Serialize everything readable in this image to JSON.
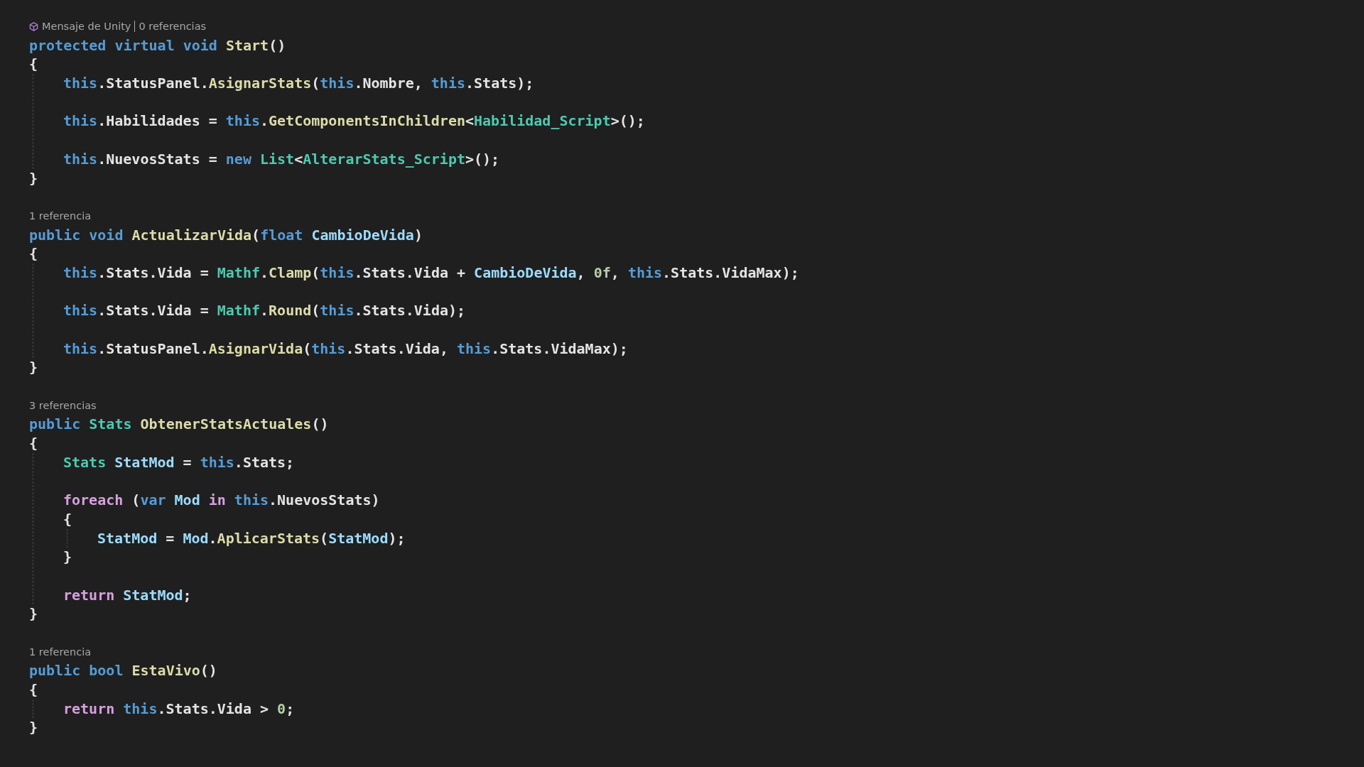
{
  "editor": {
    "members": [
      {
        "lens": [
          {
            "kind": "unity",
            "text": "Mensaje de Unity"
          },
          {
            "kind": "refs",
            "text": "0 referencias"
          }
        ],
        "signature": [
          {
            "kind": "kw",
            "text": "protected virtual void"
          },
          {
            "kind": "fn",
            "text": " Start"
          },
          {
            "kind": "p",
            "text": "()"
          }
        ],
        "open": "{",
        "close": "}",
        "body": [
          {
            "kind": "stmt",
            "tokens": [
              {
                "kind": "kw",
                "text": "this"
              },
              {
                "kind": "p",
                "text": "."
              },
              {
                "kind": "id",
                "text": "StatusPanel"
              },
              {
                "kind": "p",
                "text": "."
              },
              {
                "kind": "fn",
                "text": "AsignarStats"
              },
              {
                "kind": "p",
                "text": "("
              },
              {
                "kind": "kw",
                "text": "this"
              },
              {
                "kind": "p",
                "text": "."
              },
              {
                "kind": "id",
                "text": "Nombre"
              },
              {
                "kind": "p",
                "text": ", "
              },
              {
                "kind": "kw",
                "text": "this"
              },
              {
                "kind": "p",
                "text": "."
              },
              {
                "kind": "id",
                "text": "Stats"
              },
              {
                "kind": "p",
                "text": ");"
              }
            ]
          },
          {
            "kind": "blank"
          },
          {
            "kind": "stmt",
            "tokens": [
              {
                "kind": "kw",
                "text": "this"
              },
              {
                "kind": "p",
                "text": "."
              },
              {
                "kind": "id",
                "text": "Habilidades"
              },
              {
                "kind": "p",
                "text": " = "
              },
              {
                "kind": "kw",
                "text": "this"
              },
              {
                "kind": "p",
                "text": "."
              },
              {
                "kind": "fn",
                "text": "GetComponentsInChildren"
              },
              {
                "kind": "p",
                "text": "<"
              },
              {
                "kind": "type",
                "text": "Habilidad_Script"
              },
              {
                "kind": "p",
                "text": ">();"
              }
            ]
          },
          {
            "kind": "blank"
          },
          {
            "kind": "stmt",
            "tokens": [
              {
                "kind": "kw",
                "text": "this"
              },
              {
                "kind": "p",
                "text": "."
              },
              {
                "kind": "id",
                "text": "NuevosStats"
              },
              {
                "kind": "p",
                "text": " = "
              },
              {
                "kind": "kw",
                "text": "new"
              },
              {
                "kind": "type",
                "text": " List"
              },
              {
                "kind": "p",
                "text": "<"
              },
              {
                "kind": "type",
                "text": "AlterarStats_Script"
              },
              {
                "kind": "p",
                "text": ">();"
              }
            ]
          }
        ]
      },
      {
        "lens": [
          {
            "kind": "refs",
            "text": "1 referencia"
          }
        ],
        "signature": [
          {
            "kind": "kw",
            "text": "public void"
          },
          {
            "kind": "fn",
            "text": " ActualizarVida"
          },
          {
            "kind": "p",
            "text": "("
          },
          {
            "kind": "kw",
            "text": "float"
          },
          {
            "kind": "var",
            "text": " CambioDeVida"
          },
          {
            "kind": "p",
            "text": ")"
          }
        ],
        "open": "{",
        "close": "}",
        "body": [
          {
            "kind": "stmt",
            "tokens": [
              {
                "kind": "kw",
                "text": "this"
              },
              {
                "kind": "p",
                "text": "."
              },
              {
                "kind": "id",
                "text": "Stats"
              },
              {
                "kind": "p",
                "text": "."
              },
              {
                "kind": "id",
                "text": "Vida"
              },
              {
                "kind": "p",
                "text": " = "
              },
              {
                "kind": "type",
                "text": "Mathf"
              },
              {
                "kind": "p",
                "text": "."
              },
              {
                "kind": "fn",
                "text": "Clamp"
              },
              {
                "kind": "p",
                "text": "("
              },
              {
                "kind": "kw",
                "text": "this"
              },
              {
                "kind": "p",
                "text": "."
              },
              {
                "kind": "id",
                "text": "Stats"
              },
              {
                "kind": "p",
                "text": "."
              },
              {
                "kind": "id",
                "text": "Vida"
              },
              {
                "kind": "p",
                "text": " + "
              },
              {
                "kind": "var",
                "text": "CambioDeVida"
              },
              {
                "kind": "p",
                "text": ", "
              },
              {
                "kind": "num",
                "text": "0f"
              },
              {
                "kind": "p",
                "text": ", "
              },
              {
                "kind": "kw",
                "text": "this"
              },
              {
                "kind": "p",
                "text": "."
              },
              {
                "kind": "id",
                "text": "Stats"
              },
              {
                "kind": "p",
                "text": "."
              },
              {
                "kind": "id",
                "text": "VidaMax"
              },
              {
                "kind": "p",
                "text": ");"
              }
            ]
          },
          {
            "kind": "blank"
          },
          {
            "kind": "stmt",
            "tokens": [
              {
                "kind": "kw",
                "text": "this"
              },
              {
                "kind": "p",
                "text": "."
              },
              {
                "kind": "id",
                "text": "Stats"
              },
              {
                "kind": "p",
                "text": "."
              },
              {
                "kind": "id",
                "text": "Vida"
              },
              {
                "kind": "p",
                "text": " = "
              },
              {
                "kind": "type",
                "text": "Mathf"
              },
              {
                "kind": "p",
                "text": "."
              },
              {
                "kind": "fn",
                "text": "Round"
              },
              {
                "kind": "p",
                "text": "("
              },
              {
                "kind": "kw",
                "text": "this"
              },
              {
                "kind": "p",
                "text": "."
              },
              {
                "kind": "id",
                "text": "Stats"
              },
              {
                "kind": "p",
                "text": "."
              },
              {
                "kind": "id",
                "text": "Vida"
              },
              {
                "kind": "p",
                "text": ");"
              }
            ]
          },
          {
            "kind": "blank"
          },
          {
            "kind": "stmt",
            "tokens": [
              {
                "kind": "kw",
                "text": "this"
              },
              {
                "kind": "p",
                "text": "."
              },
              {
                "kind": "id",
                "text": "StatusPanel"
              },
              {
                "kind": "p",
                "text": "."
              },
              {
                "kind": "fn",
                "text": "AsignarVida"
              },
              {
                "kind": "p",
                "text": "("
              },
              {
                "kind": "kw",
                "text": "this"
              },
              {
                "kind": "p",
                "text": "."
              },
              {
                "kind": "id",
                "text": "Stats"
              },
              {
                "kind": "p",
                "text": "."
              },
              {
                "kind": "id",
                "text": "Vida"
              },
              {
                "kind": "p",
                "text": ", "
              },
              {
                "kind": "kw",
                "text": "this"
              },
              {
                "kind": "p",
                "text": "."
              },
              {
                "kind": "id",
                "text": "Stats"
              },
              {
                "kind": "p",
                "text": "."
              },
              {
                "kind": "id",
                "text": "VidaMax"
              },
              {
                "kind": "p",
                "text": ");"
              }
            ]
          }
        ]
      },
      {
        "lens": [
          {
            "kind": "refs",
            "text": "3 referencias"
          }
        ],
        "signature": [
          {
            "kind": "kw",
            "text": "public"
          },
          {
            "kind": "type",
            "text": " Stats"
          },
          {
            "kind": "fn",
            "text": " ObtenerStatsActuales"
          },
          {
            "kind": "p",
            "text": "()"
          }
        ],
        "open": "{",
        "close": "}",
        "body": [
          {
            "kind": "stmt",
            "tokens": [
              {
                "kind": "type",
                "text": "Stats"
              },
              {
                "kind": "var",
                "text": " StatMod"
              },
              {
                "kind": "p",
                "text": " = "
              },
              {
                "kind": "kw",
                "text": "this"
              },
              {
                "kind": "p",
                "text": "."
              },
              {
                "kind": "id",
                "text": "Stats"
              },
              {
                "kind": "p",
                "text": ";"
              }
            ]
          },
          {
            "kind": "blank"
          },
          {
            "kind": "block",
            "header": [
              {
                "kind": "ctl",
                "text": "foreach"
              },
              {
                "kind": "p",
                "text": " ("
              },
              {
                "kind": "kw",
                "text": "var"
              },
              {
                "kind": "var",
                "text": " Mod"
              },
              {
                "kind": "ctl",
                "text": " in"
              },
              {
                "kind": "kw",
                "text": " this"
              },
              {
                "kind": "p",
                "text": "."
              },
              {
                "kind": "id",
                "text": "NuevosStats"
              },
              {
                "kind": "p",
                "text": ")"
              }
            ],
            "open": "{",
            "close": "}",
            "body": [
              {
                "kind": "stmt",
                "tokens": [
                  {
                    "kind": "var",
                    "text": "StatMod"
                  },
                  {
                    "kind": "p",
                    "text": " = "
                  },
                  {
                    "kind": "var",
                    "text": "Mod"
                  },
                  {
                    "kind": "p",
                    "text": "."
                  },
                  {
                    "kind": "fn",
                    "text": "AplicarStats"
                  },
                  {
                    "kind": "p",
                    "text": "("
                  },
                  {
                    "kind": "var",
                    "text": "StatMod"
                  },
                  {
                    "kind": "p",
                    "text": ");"
                  }
                ]
              }
            ]
          },
          {
            "kind": "blank"
          },
          {
            "kind": "stmt",
            "tokens": [
              {
                "kind": "ctl",
                "text": "return"
              },
              {
                "kind": "var",
                "text": " StatMod"
              },
              {
                "kind": "p",
                "text": ";"
              }
            ]
          }
        ]
      },
      {
        "lens": [
          {
            "kind": "refs",
            "text": "1 referencia"
          }
        ],
        "signature": [
          {
            "kind": "kw",
            "text": "public bool"
          },
          {
            "kind": "fn",
            "text": " EstaVivo"
          },
          {
            "kind": "p",
            "text": "()"
          }
        ],
        "open": "{",
        "close": "}",
        "body": [
          {
            "kind": "stmt",
            "tokens": [
              {
                "kind": "ctl",
                "text": "return"
              },
              {
                "kind": "kw",
                "text": " this"
              },
              {
                "kind": "p",
                "text": "."
              },
              {
                "kind": "id",
                "text": "Stats"
              },
              {
                "kind": "p",
                "text": "."
              },
              {
                "kind": "id",
                "text": "Vida"
              },
              {
                "kind": "p",
                "text": " > "
              },
              {
                "kind": "num",
                "text": "0"
              },
              {
                "kind": "p",
                "text": ";"
              }
            ]
          }
        ]
      }
    ]
  }
}
